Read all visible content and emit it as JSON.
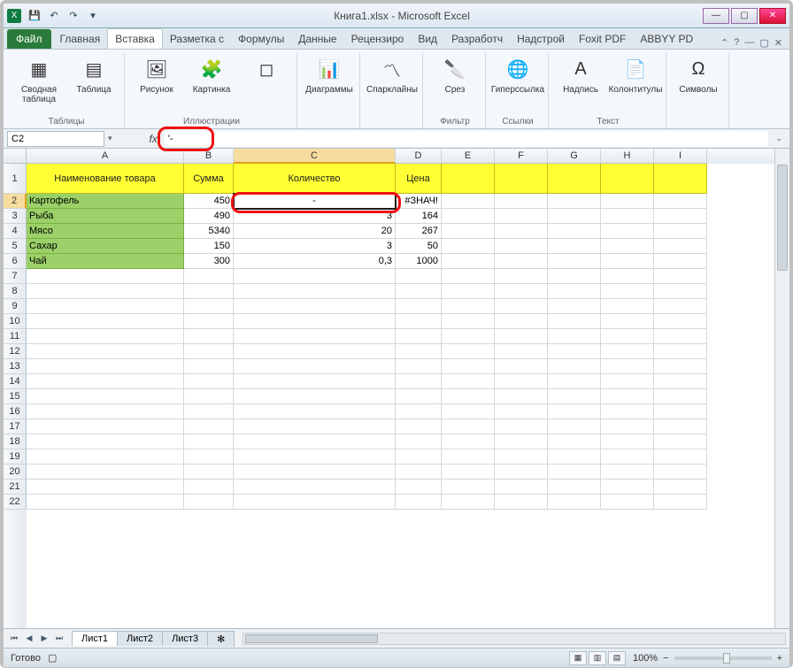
{
  "title": "Книга1.xlsx - Microsoft Excel",
  "qat": {
    "save": "💾",
    "undo": "↶",
    "redo": "↷"
  },
  "tabs": {
    "file": "Файл",
    "items": [
      "Главная",
      "Вставка",
      "Разметка с",
      "Формулы",
      "Данные",
      "Рецензиро",
      "Вид",
      "Разработч",
      "Надстрой",
      "Foxit PDF",
      "ABBYY PD"
    ],
    "active_index": 1
  },
  "ribbon": {
    "groups": [
      {
        "label": "Таблицы",
        "items": [
          {
            "name": "pivot-table",
            "label": "Сводная таблица",
            "icon": "▦"
          },
          {
            "name": "table",
            "label": "Таблица",
            "icon": "▤"
          }
        ]
      },
      {
        "label": "Иллюстрации",
        "items": [
          {
            "name": "picture",
            "label": "Рисунок",
            "icon": "🖼"
          },
          {
            "name": "clipart",
            "label": "Картинка",
            "icon": "🧩"
          },
          {
            "name": "shapes",
            "label": "",
            "icon": "◻"
          }
        ]
      },
      {
        "label": "",
        "items": [
          {
            "name": "charts",
            "label": "Диаграммы",
            "icon": "📊"
          }
        ]
      },
      {
        "label": "",
        "items": [
          {
            "name": "sparklines",
            "label": "Спарклайны",
            "icon": "〽"
          }
        ]
      },
      {
        "label": "Фильтр",
        "items": [
          {
            "name": "slicer",
            "label": "Срез",
            "icon": "🔪"
          }
        ]
      },
      {
        "label": "Ссылки",
        "items": [
          {
            "name": "hyperlink",
            "label": "Гиперссылка",
            "icon": "🌐"
          }
        ]
      },
      {
        "label": "Текст",
        "items": [
          {
            "name": "textbox",
            "label": "Надпись",
            "icon": "A"
          },
          {
            "name": "headerfooter",
            "label": "Колонтитулы",
            "icon": "📄"
          }
        ]
      },
      {
        "label": "",
        "items": [
          {
            "name": "symbols",
            "label": "Символы",
            "icon": "Ω"
          }
        ]
      }
    ]
  },
  "namebox": "C2",
  "formula": "'-",
  "columns": [
    "A",
    "B",
    "C",
    "D",
    "E",
    "F",
    "G",
    "H",
    "I"
  ],
  "selected_col": "C",
  "selected_row": 2,
  "header_row": [
    "Наименование товара",
    "Сумма",
    "Количество",
    "Цена"
  ],
  "data_rows": [
    {
      "name": "Картофель",
      "sum": "450",
      "qty": "-",
      "price": "#ЗНАЧ!"
    },
    {
      "name": "Рыба",
      "sum": "490",
      "qty": "3",
      "price": "164"
    },
    {
      "name": "Мясо",
      "sum": "5340",
      "qty": "20",
      "price": "267"
    },
    {
      "name": "Сахар",
      "sum": "150",
      "qty": "3",
      "price": "50"
    },
    {
      "name": "Чай",
      "sum": "300",
      "qty": "0,3",
      "price": "1000"
    }
  ],
  "sheets": [
    "Лист1",
    "Лист2",
    "Лист3"
  ],
  "status": "Готово",
  "zoom": "100%"
}
